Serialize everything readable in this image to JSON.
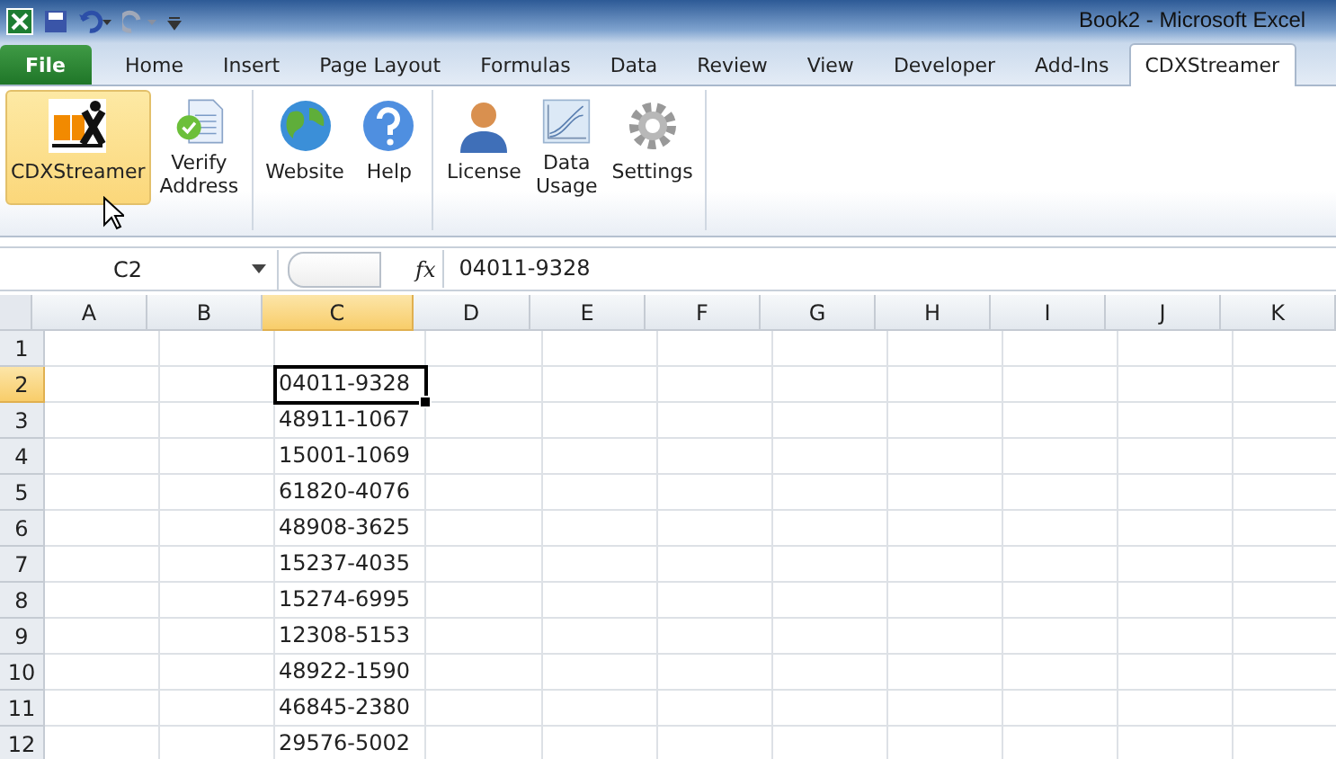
{
  "window": {
    "title": "Book2  -  Microsoft Excel"
  },
  "tabs": [
    {
      "label": "File",
      "kind": "file",
      "selected": false
    },
    {
      "label": "Home",
      "kind": "tab",
      "selected": false
    },
    {
      "label": "Insert",
      "kind": "tab",
      "selected": false
    },
    {
      "label": "Page Layout",
      "kind": "tab",
      "selected": false
    },
    {
      "label": "Formulas",
      "kind": "tab",
      "selected": false
    },
    {
      "label": "Data",
      "kind": "tab",
      "selected": false
    },
    {
      "label": "Review",
      "kind": "tab",
      "selected": false
    },
    {
      "label": "View",
      "kind": "tab",
      "selected": false
    },
    {
      "label": "Developer",
      "kind": "tab",
      "selected": false
    },
    {
      "label": "Add-Ins",
      "kind": "tab",
      "selected": false
    },
    {
      "label": "CDXStreamer",
      "kind": "tab",
      "selected": true
    }
  ],
  "ribbon": {
    "groups": [
      [
        {
          "label": "CDXStreamer",
          "kind": "logo",
          "highlighted": true
        },
        {
          "label": "Verify\nAddress",
          "kind": "verify",
          "highlighted": false
        }
      ],
      [
        {
          "label": "Website",
          "kind": "globe",
          "highlighted": false
        },
        {
          "label": "Help",
          "kind": "help",
          "highlighted": false
        }
      ],
      [
        {
          "label": "License",
          "kind": "person",
          "highlighted": false
        },
        {
          "label": "Data\nUsage",
          "kind": "chart",
          "highlighted": false
        },
        {
          "label": "Settings",
          "kind": "gear",
          "highlighted": false
        }
      ]
    ]
  },
  "formula_bar": {
    "name_box": "C2",
    "fx": "fx",
    "value": "04011-9328"
  },
  "sheet": {
    "columns": [
      {
        "label": "A",
        "selected": false
      },
      {
        "label": "B",
        "selected": false
      },
      {
        "label": "C",
        "selected": true
      },
      {
        "label": "D",
        "selected": false
      },
      {
        "label": "E",
        "selected": false
      },
      {
        "label": "F",
        "selected": false
      },
      {
        "label": "G",
        "selected": false
      },
      {
        "label": "H",
        "selected": false
      },
      {
        "label": "I",
        "selected": false
      },
      {
        "label": "J",
        "selected": false
      },
      {
        "label": "K",
        "selected": false
      }
    ],
    "rows": [
      {
        "label": "1",
        "selected": false
      },
      {
        "label": "2",
        "selected": true,
        "cell_c": "04011-9328"
      },
      {
        "label": "3",
        "selected": false,
        "cell_c": "48911-1067"
      },
      {
        "label": "4",
        "selected": false,
        "cell_c": "15001-1069"
      },
      {
        "label": "5",
        "selected": false,
        "cell_c": "61820-4076"
      },
      {
        "label": "6",
        "selected": false,
        "cell_c": "48908-3625"
      },
      {
        "label": "7",
        "selected": false,
        "cell_c": "15237-4035"
      },
      {
        "label": "8",
        "selected": false,
        "cell_c": "15274-6995"
      },
      {
        "label": "9",
        "selected": false,
        "cell_c": "12308-5153"
      },
      {
        "label": "10",
        "selected": false,
        "cell_c": "48922-1590"
      },
      {
        "label": "11",
        "selected": false,
        "cell_c": "46845-2380"
      },
      {
        "label": "12",
        "selected": false,
        "cell_c": "29576-5002"
      }
    ]
  }
}
